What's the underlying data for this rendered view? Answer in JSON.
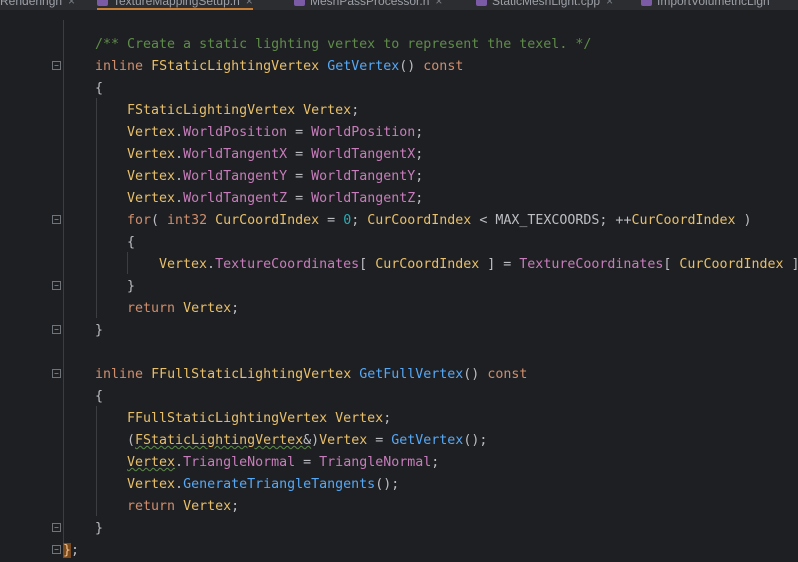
{
  "tabs": [
    {
      "label": "xRenderingh",
      "active": false
    },
    {
      "label": "TextureMappingSetup.h",
      "active": true
    },
    {
      "label": "MeshPassProcessor.h",
      "active": false
    },
    {
      "label": "StaticMeshLight.cpp",
      "active": false
    },
    {
      "label": "ImportVolumetricLigh",
      "active": false
    }
  ],
  "code": {
    "comment1": "/** Create a static lighting vertex to represent the texel. */",
    "kw_inline": "inline",
    "kw_const": "const",
    "kw_for": "for",
    "kw_return": "return",
    "kw_int32": "int32",
    "type_vertex": "FStaticLightingVertex",
    "type_full_vertex": "FFullStaticLightingVertex",
    "fn_getvertex": "GetVertex",
    "fn_getfullvertex": "GetFullVertex",
    "fn_generate": "GenerateTriangleTangents",
    "var_vertex": "Vertex",
    "var_index": "CurCoordIndex",
    "field_worldposition": "WorldPosition",
    "field_tangentx": "WorldTangentX",
    "field_tangenty": "WorldTangentY",
    "field_tangentz": "WorldTangentZ",
    "field_texcoords": "TextureCoordinates",
    "field_trinormal": "TriangleNormal",
    "const_max": "MAX_TEXCOORDS",
    "num_zero": "0",
    "brace_open": "{",
    "brace_close": "}",
    "final_close": "};"
  },
  "colors": {
    "background": "#1e1f22",
    "keyword": "#cf8e6d",
    "comment": "#5f8c4a",
    "function": "#56a8f5",
    "field": "#c77dbb",
    "type": "#e8bf6a",
    "active_tab_underline": "#c77d34"
  }
}
